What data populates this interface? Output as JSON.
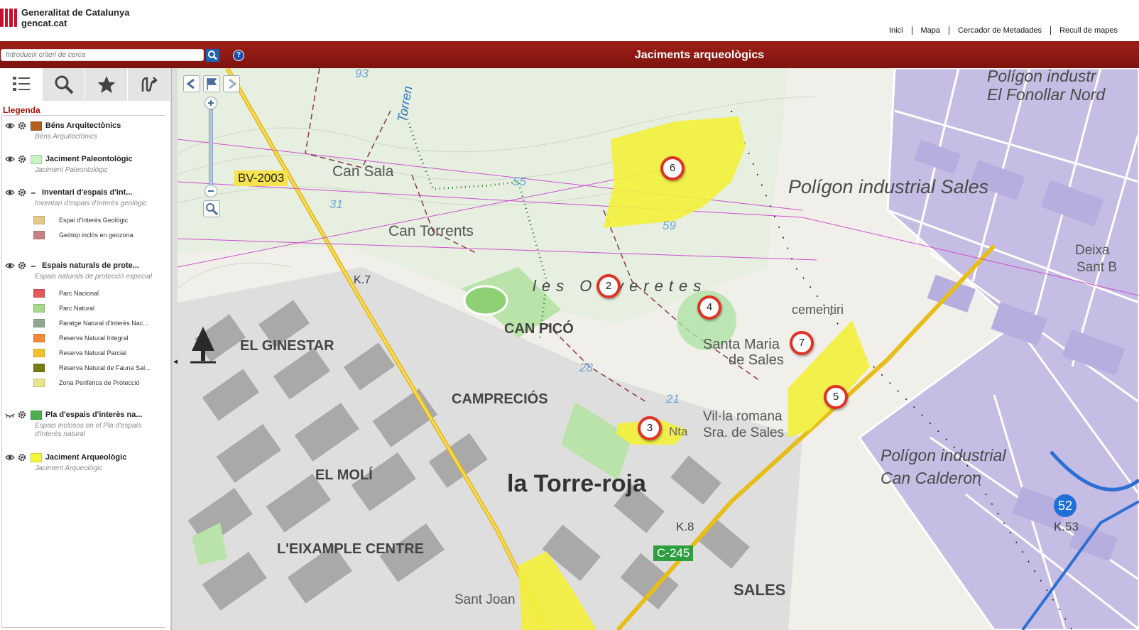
{
  "header": {
    "org_name": "Generalitat de Catalunya",
    "org_site": "gencat.cat",
    "nav": [
      "Inici",
      "Mapa",
      "Cercador de Metadades",
      "Recull de mapes"
    ]
  },
  "titlebar": {
    "search_placeholder": "Introdueix criteri de cerca",
    "help": "?",
    "title": "Jaciments arqueològics"
  },
  "panel": {
    "tabs": [
      "legend-icon",
      "search-icon",
      "star-icon",
      "route-icon"
    ],
    "legend_title": "Llegenda",
    "layers": [
      {
        "name": "Béns Arquitectònics",
        "desc": "Béns Arquitectònics",
        "color": "#b35f1e"
      },
      {
        "name": "Jaciment Paleontològic",
        "desc": "Jaciment Paleontològic",
        "color": "#c7f5c2"
      },
      {
        "name": "Inventari d'espais d'int...",
        "desc": "Inventari d'espais d'interès geològic",
        "items": [
          {
            "label": "Espai d'Interès Geològic",
            "color": "#e5c98a"
          },
          {
            "label": "Geòtop inclòs en geozona",
            "color": "#c98080"
          }
        ]
      },
      {
        "name": "Espais naturals de prote...",
        "desc": "Espais naturals de protecció especial",
        "items": [
          {
            "label": "Parc Nacional",
            "color": "#e05a5a"
          },
          {
            "label": "Parc Natural",
            "color": "#a9d88a"
          },
          {
            "label": "Paratge Natural d'Interès Nac...",
            "color": "#8fa88f"
          },
          {
            "label": "Reserva Natural Integral",
            "color": "#f28a3a"
          },
          {
            "label": "Reserva Natural Parcial",
            "color": "#f2c12e"
          },
          {
            "label": "Reserva Natural de Fauna Sal...",
            "color": "#7a7a12"
          },
          {
            "label": "Zona Perifèrica de Protecció",
            "color": "#e6e68c"
          }
        ]
      },
      {
        "name": "Pla d'espais d'interès na...",
        "desc": "Espais inclosos en el Pla d'espais d'interès natural",
        "color": "#4caf50"
      },
      {
        "name": "Jaciment Arqueològic",
        "desc": "Jaciment Arqueològic",
        "color": "#f5f53a"
      }
    ]
  },
  "map": {
    "markers": [
      "6",
      "2",
      "4",
      "7",
      "5",
      "3"
    ],
    "labels": {
      "road_bv": "BV-2003",
      "road_c": "C-245",
      "road_52": "52",
      "can_sala": "Can Sala",
      "can_torrents": "Can Torrents",
      "torrent": "Torren",
      "les_oliveretes": "les Oliveretes",
      "can_pico": "CAN PICÓ",
      "el_ginestar": "EL GINESTAR",
      "campreciós": "CAMPRECIÓS",
      "el_moli": "EL MOLÍ",
      "la_torre_roja": "la Torre-roja",
      "eixample": "L'EIXAMPLE CENTRE",
      "sales": "SALES",
      "sant_joan": "Sant Joan",
      "poligon_sales": "Polígon industrial Sales",
      "poligon_fonollar_1": "Polígon industr",
      "poligon_fonollar_2": "El Fonollar Nord",
      "poligon_calderon_1": "Polígon industrial",
      "poligon_calderon_2": "Can Calderon",
      "cementiri": "cementiri",
      "santa_maria_1": "Santa Maria",
      "santa_maria_2": "de Sales",
      "villa_1": "Vil·la romana",
      "villa_2": "Sra. de Sales",
      "deixa_1": "Deixa",
      "deixa_2": "Sant B",
      "k7": "K.7",
      "k8": "K.8",
      "k53": "K.53",
      "h93": "93",
      "h31": "31",
      "h55": "55",
      "h59": "59",
      "h28": "28",
      "h21": "21",
      "nta": "Nta"
    }
  }
}
